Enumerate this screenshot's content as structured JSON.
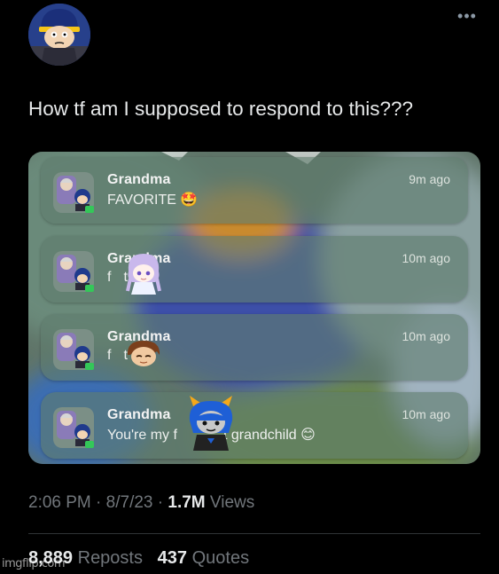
{
  "header": {
    "more_icon": "ellipsis-icon",
    "more_label": "•••"
  },
  "tweet": {
    "text": "How tf am I supposed to respond to this???"
  },
  "notifications": [
    {
      "sender": "Grandma",
      "message": "FAVORITE",
      "emoji": "🤩",
      "time": "9m ago"
    },
    {
      "sender": "Grandma",
      "message": "f",
      "message_tail": "t",
      "time": "10m ago"
    },
    {
      "sender": "Grandma",
      "message": "f",
      "message_tail": "t",
      "time": "10m ago"
    },
    {
      "sender": "Grandma",
      "message": "You're my f",
      "message_tail": "t grandchild",
      "emoji": "😊",
      "time": "10m ago"
    }
  ],
  "meta": {
    "time": "2:06 PM",
    "sep1": " · ",
    "date": "8/7/23",
    "sep2": " · ",
    "views_count": "1.7M",
    "views_label": " Views"
  },
  "stats": {
    "reposts_count": "8,889",
    "reposts_label": " Reposts",
    "quotes_count": "437",
    "quotes_label": " Quotes"
  },
  "watermark": "imgflip.com",
  "colors": {
    "background": "#000000",
    "text": "#e7e9ea",
    "muted": "#71767b",
    "notification": "#5f7d6e"
  }
}
